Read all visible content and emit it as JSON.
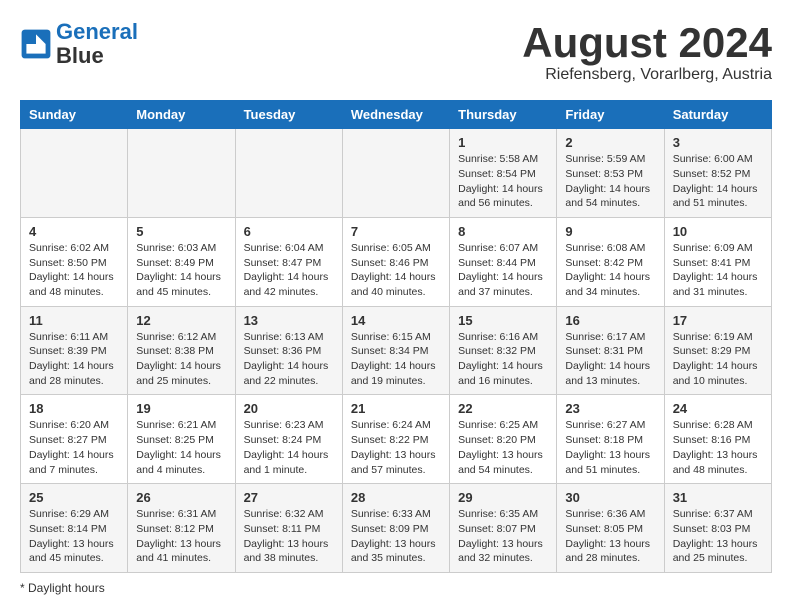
{
  "header": {
    "logo_line1": "General",
    "logo_line2": "Blue",
    "month": "August 2024",
    "location": "Riefensberg, Vorarlberg, Austria"
  },
  "weekdays": [
    "Sunday",
    "Monday",
    "Tuesday",
    "Wednesday",
    "Thursday",
    "Friday",
    "Saturday"
  ],
  "weeks": [
    [
      {
        "day": "",
        "sunrise": "",
        "sunset": "",
        "daylight": ""
      },
      {
        "day": "",
        "sunrise": "",
        "sunset": "",
        "daylight": ""
      },
      {
        "day": "",
        "sunrise": "",
        "sunset": "",
        "daylight": ""
      },
      {
        "day": "",
        "sunrise": "",
        "sunset": "",
        "daylight": ""
      },
      {
        "day": "1",
        "sunrise": "Sunrise: 5:58 AM",
        "sunset": "Sunset: 8:54 PM",
        "daylight": "Daylight: 14 hours and 56 minutes."
      },
      {
        "day": "2",
        "sunrise": "Sunrise: 5:59 AM",
        "sunset": "Sunset: 8:53 PM",
        "daylight": "Daylight: 14 hours and 54 minutes."
      },
      {
        "day": "3",
        "sunrise": "Sunrise: 6:00 AM",
        "sunset": "Sunset: 8:52 PM",
        "daylight": "Daylight: 14 hours and 51 minutes."
      }
    ],
    [
      {
        "day": "4",
        "sunrise": "Sunrise: 6:02 AM",
        "sunset": "Sunset: 8:50 PM",
        "daylight": "Daylight: 14 hours and 48 minutes."
      },
      {
        "day": "5",
        "sunrise": "Sunrise: 6:03 AM",
        "sunset": "Sunset: 8:49 PM",
        "daylight": "Daylight: 14 hours and 45 minutes."
      },
      {
        "day": "6",
        "sunrise": "Sunrise: 6:04 AM",
        "sunset": "Sunset: 8:47 PM",
        "daylight": "Daylight: 14 hours and 42 minutes."
      },
      {
        "day": "7",
        "sunrise": "Sunrise: 6:05 AM",
        "sunset": "Sunset: 8:46 PM",
        "daylight": "Daylight: 14 hours and 40 minutes."
      },
      {
        "day": "8",
        "sunrise": "Sunrise: 6:07 AM",
        "sunset": "Sunset: 8:44 PM",
        "daylight": "Daylight: 14 hours and 37 minutes."
      },
      {
        "day": "9",
        "sunrise": "Sunrise: 6:08 AM",
        "sunset": "Sunset: 8:42 PM",
        "daylight": "Daylight: 14 hours and 34 minutes."
      },
      {
        "day": "10",
        "sunrise": "Sunrise: 6:09 AM",
        "sunset": "Sunset: 8:41 PM",
        "daylight": "Daylight: 14 hours and 31 minutes."
      }
    ],
    [
      {
        "day": "11",
        "sunrise": "Sunrise: 6:11 AM",
        "sunset": "Sunset: 8:39 PM",
        "daylight": "Daylight: 14 hours and 28 minutes."
      },
      {
        "day": "12",
        "sunrise": "Sunrise: 6:12 AM",
        "sunset": "Sunset: 8:38 PM",
        "daylight": "Daylight: 14 hours and 25 minutes."
      },
      {
        "day": "13",
        "sunrise": "Sunrise: 6:13 AM",
        "sunset": "Sunset: 8:36 PM",
        "daylight": "Daylight: 14 hours and 22 minutes."
      },
      {
        "day": "14",
        "sunrise": "Sunrise: 6:15 AM",
        "sunset": "Sunset: 8:34 PM",
        "daylight": "Daylight: 14 hours and 19 minutes."
      },
      {
        "day": "15",
        "sunrise": "Sunrise: 6:16 AM",
        "sunset": "Sunset: 8:32 PM",
        "daylight": "Daylight: 14 hours and 16 minutes."
      },
      {
        "day": "16",
        "sunrise": "Sunrise: 6:17 AM",
        "sunset": "Sunset: 8:31 PM",
        "daylight": "Daylight: 14 hours and 13 minutes."
      },
      {
        "day": "17",
        "sunrise": "Sunrise: 6:19 AM",
        "sunset": "Sunset: 8:29 PM",
        "daylight": "Daylight: 14 hours and 10 minutes."
      }
    ],
    [
      {
        "day": "18",
        "sunrise": "Sunrise: 6:20 AM",
        "sunset": "Sunset: 8:27 PM",
        "daylight": "Daylight: 14 hours and 7 minutes."
      },
      {
        "day": "19",
        "sunrise": "Sunrise: 6:21 AM",
        "sunset": "Sunset: 8:25 PM",
        "daylight": "Daylight: 14 hours and 4 minutes."
      },
      {
        "day": "20",
        "sunrise": "Sunrise: 6:23 AM",
        "sunset": "Sunset: 8:24 PM",
        "daylight": "Daylight: 14 hours and 1 minute."
      },
      {
        "day": "21",
        "sunrise": "Sunrise: 6:24 AM",
        "sunset": "Sunset: 8:22 PM",
        "daylight": "Daylight: 13 hours and 57 minutes."
      },
      {
        "day": "22",
        "sunrise": "Sunrise: 6:25 AM",
        "sunset": "Sunset: 8:20 PM",
        "daylight": "Daylight: 13 hours and 54 minutes."
      },
      {
        "day": "23",
        "sunrise": "Sunrise: 6:27 AM",
        "sunset": "Sunset: 8:18 PM",
        "daylight": "Daylight: 13 hours and 51 minutes."
      },
      {
        "day": "24",
        "sunrise": "Sunrise: 6:28 AM",
        "sunset": "Sunset: 8:16 PM",
        "daylight": "Daylight: 13 hours and 48 minutes."
      }
    ],
    [
      {
        "day": "25",
        "sunrise": "Sunrise: 6:29 AM",
        "sunset": "Sunset: 8:14 PM",
        "daylight": "Daylight: 13 hours and 45 minutes."
      },
      {
        "day": "26",
        "sunrise": "Sunrise: 6:31 AM",
        "sunset": "Sunset: 8:12 PM",
        "daylight": "Daylight: 13 hours and 41 minutes."
      },
      {
        "day": "27",
        "sunrise": "Sunrise: 6:32 AM",
        "sunset": "Sunset: 8:11 PM",
        "daylight": "Daylight: 13 hours and 38 minutes."
      },
      {
        "day": "28",
        "sunrise": "Sunrise: 6:33 AM",
        "sunset": "Sunset: 8:09 PM",
        "daylight": "Daylight: 13 hours and 35 minutes."
      },
      {
        "day": "29",
        "sunrise": "Sunrise: 6:35 AM",
        "sunset": "Sunset: 8:07 PM",
        "daylight": "Daylight: 13 hours and 32 minutes."
      },
      {
        "day": "30",
        "sunrise": "Sunrise: 6:36 AM",
        "sunset": "Sunset: 8:05 PM",
        "daylight": "Daylight: 13 hours and 28 minutes."
      },
      {
        "day": "31",
        "sunrise": "Sunrise: 6:37 AM",
        "sunset": "Sunset: 8:03 PM",
        "daylight": "Daylight: 13 hours and 25 minutes."
      }
    ]
  ],
  "legend": "Daylight hours"
}
